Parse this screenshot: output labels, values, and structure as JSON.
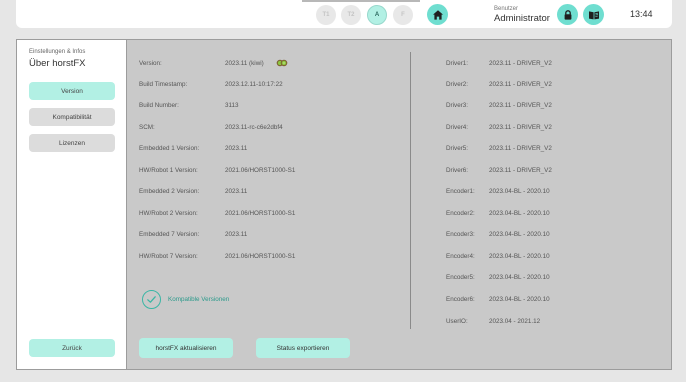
{
  "topbar": {
    "mode_buttons": [
      {
        "label": "T1",
        "active": false
      },
      {
        "label": "T2",
        "active": false
      },
      {
        "label": "A",
        "active": true
      },
      {
        "label": "F",
        "active": false
      }
    ],
    "user_role": "Benutzer",
    "user_name": "Administrator",
    "clock": "13:44",
    "icons": [
      "home-icon",
      "lock-icon",
      "manual-book-icon"
    ]
  },
  "sidebar": {
    "section": "Einstellungen & Infos",
    "title": "Über horstFX",
    "items": [
      {
        "label": "Version",
        "active": true
      },
      {
        "label": "Kompatibilität",
        "active": false
      },
      {
        "label": "Lizenzen",
        "active": false
      }
    ],
    "back": "Zurück"
  },
  "info_left": [
    {
      "label": "Version:",
      "value": "2023.11  (kiwi)"
    },
    {
      "label": "Build Timestamp:",
      "value": "2023.12.11-10:17:22"
    },
    {
      "label": "Build Number:",
      "value": "3113"
    },
    {
      "label": "SCM:",
      "value": "2023.11-rc-c6e2dbf4"
    },
    {
      "label": "Embedded 1 Version:",
      "value": "2023.11"
    },
    {
      "label": "HW/Robot 1 Version:",
      "value": "2021.06/HORST1000-S1"
    },
    {
      "label": "Embedded 2 Version:",
      "value": "2023.11"
    },
    {
      "label": "HW/Robot 2 Version:",
      "value": "2021.06/HORST1000-S1"
    },
    {
      "label": "Embedded 7 Version:",
      "value": "2023.11"
    },
    {
      "label": "HW/Robot 7 Version:",
      "value": "2021.06/HORST1000-S1"
    }
  ],
  "info_right": [
    {
      "label": "Driver1:",
      "value": "2023.11 - DRIVER_V2"
    },
    {
      "label": "Driver2:",
      "value": "2023.11 - DRIVER_V2"
    },
    {
      "label": "Driver3:",
      "value": "2023.11 - DRIVER_V2"
    },
    {
      "label": "Driver4:",
      "value": "2023.11 - DRIVER_V2"
    },
    {
      "label": "Driver5:",
      "value": "2023.11 - DRIVER_V2"
    },
    {
      "label": "Driver6:",
      "value": "2023.11 - DRIVER_V2"
    },
    {
      "label": "Encoder1:",
      "value": "2023.04-BL - 2020.10"
    },
    {
      "label": "Encoder2:",
      "value": "2023.04-BL - 2020.10"
    },
    {
      "label": "Encoder3:",
      "value": "2023.04-BL - 2020.10"
    },
    {
      "label": "Encoder4:",
      "value": "2023.04-BL - 2020.10"
    },
    {
      "label": "Encoder5:",
      "value": "2023.04-BL - 2020.10"
    },
    {
      "label": "Encoder6:",
      "value": "2023.04-BL - 2020.10"
    },
    {
      "label": "UserIO:",
      "value": "2023.04 - 2021.12"
    }
  ],
  "compatibility": {
    "label": "Kompatible Versionen",
    "icon": "check-circle-icon"
  },
  "actions": {
    "update": "horstFX aktualisieren",
    "export": "Status exportieren"
  },
  "colors": {
    "accent": "#b2f0e4",
    "accent_strong": "#6fded0",
    "content_bg": "#c9c9c9",
    "success": "#3ab6a5"
  }
}
